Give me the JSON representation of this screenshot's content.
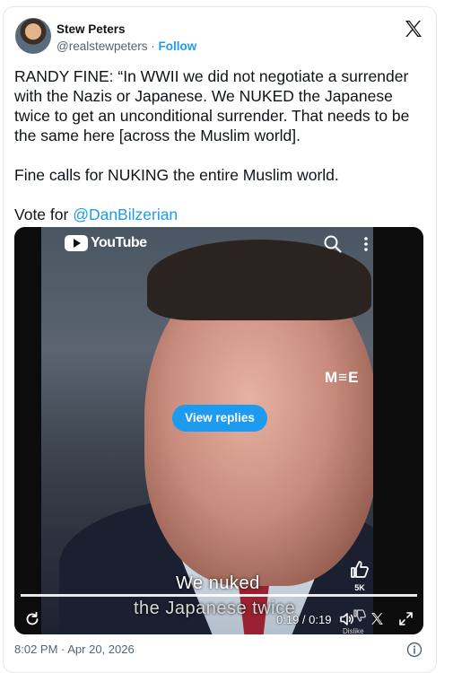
{
  "author": {
    "name": "Stew Peters",
    "handle": "@realstewpeters",
    "separator": " · ",
    "follow_label": "Follow"
  },
  "tweet": {
    "paragraph1": "RANDY FINE: “In WWII we did not negotiate a surrender with the Nazis or Japanese. We NUKED the Japanese twice to get an unconditional surrender. That needs to be the same here [across the Muslim world].",
    "paragraph2": "Fine calls for NUKING the entire Muslim world.",
    "vote_prefix": "Vote for ",
    "mention": "@DanBilzerian"
  },
  "video": {
    "youtube_label": "YouTube",
    "channel_watermark": "M≡E",
    "view_replies_label": "View replies",
    "like_count": "5K",
    "dislike_label": "Dislike",
    "caption_line1": "We nuked",
    "caption_line2": "the Japanese twice",
    "time_display": "0:19 / 0:19",
    "progress": 1.0
  },
  "footer": {
    "timestamp": "8:02 PM · Apr 20, 2026"
  },
  "colors": {
    "accent": "#1d9bf0",
    "text": "#0f1419",
    "muted": "#536471"
  }
}
